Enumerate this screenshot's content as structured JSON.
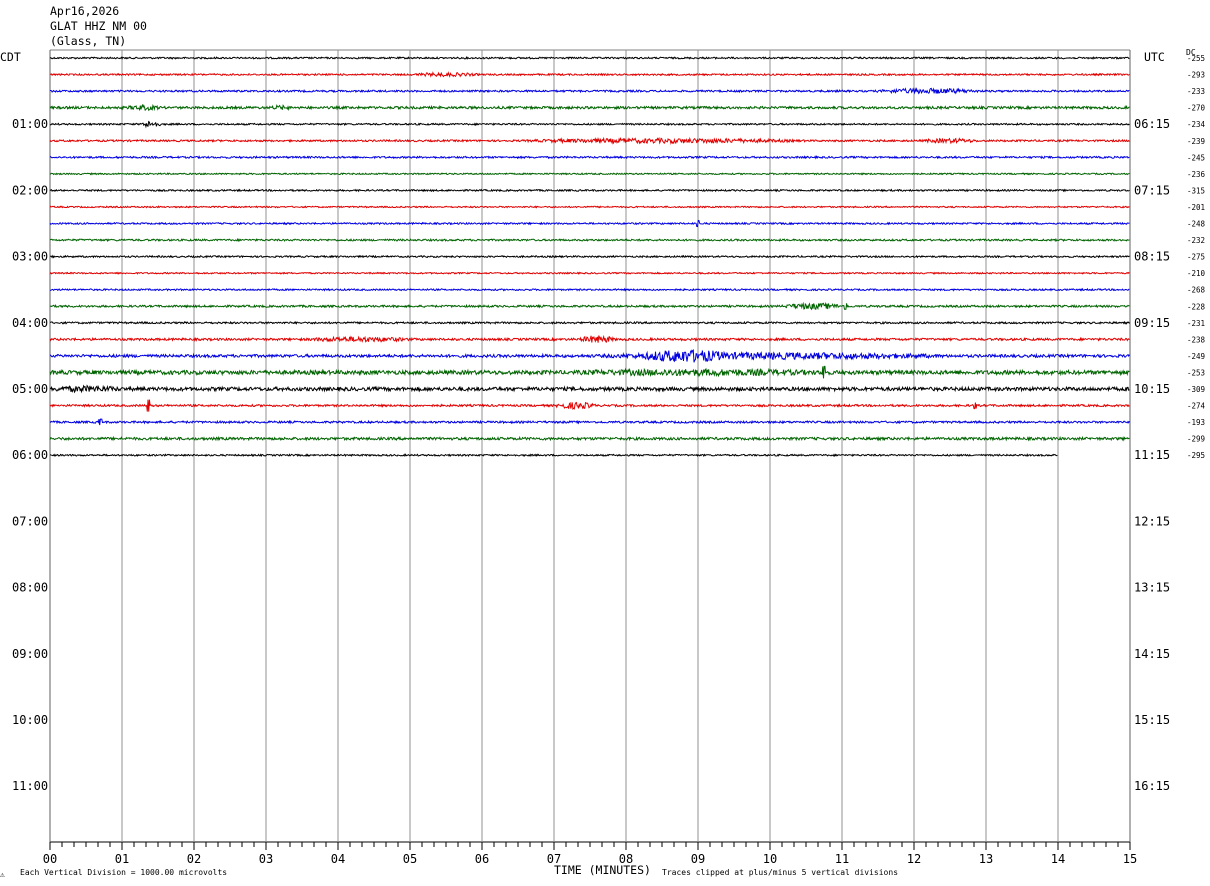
{
  "header": {
    "date": "Apr16,2026",
    "station": "GLAT HHZ NM 00",
    "location": "(Glass, TN)"
  },
  "labels": {
    "left_tz": "CDT",
    "right_tz": "UTC",
    "dc_header": "DC"
  },
  "footer": {
    "left_note": "Each Vertical Division = 1000.00 microvolts",
    "xlabel": "TIME (MINUTES)",
    "right_note": "Traces clipped at plus/minus 5 vertical divisions",
    "corner_mark": "⚠"
  },
  "chart_data": {
    "type": "line",
    "title": "GLAT HHZ NM 00",
    "xlabel": "TIME (MINUTES)",
    "xlim": [
      0,
      15
    ],
    "x_ticks": [
      "00",
      "01",
      "02",
      "03",
      "04",
      "05",
      "06",
      "07",
      "08",
      "09",
      "10",
      "11",
      "12",
      "13",
      "14",
      "15"
    ],
    "rows_total": 48,
    "rows_per_hour": 4,
    "left_hour_labels": [
      "01:00",
      "02:00",
      "03:00",
      "04:00",
      "05:00",
      "06:00",
      "07:00",
      "08:00",
      "09:00",
      "10:00",
      "11:00"
    ],
    "right_hour_labels": [
      "06:15",
      "07:15",
      "08:15",
      "09:15",
      "10:15",
      "11:15",
      "12:15",
      "13:15",
      "14:15",
      "15:15",
      "16:15"
    ],
    "trace_colors": [
      "#000000",
      "#e00000",
      "#0000e0",
      "#006400"
    ],
    "grid": true,
    "series": [
      {
        "start": "00:00",
        "dc": "-255",
        "amp": 0.8,
        "end_min": 15
      },
      {
        "start": "00:15",
        "dc": "-293",
        "amp": 0.8,
        "end_min": 15,
        "bursts": [
          [
            5.5,
            1.0,
            1.2
          ]
        ]
      },
      {
        "start": "00:30",
        "dc": "-233",
        "amp": 0.9,
        "end_min": 15,
        "bursts": [
          [
            12.2,
            1.5,
            1.8
          ]
        ]
      },
      {
        "start": "00:45",
        "dc": "-270",
        "amp": 1.2,
        "end_min": 15,
        "bursts": [
          [
            1.3,
            0.5,
            1.5
          ],
          [
            3.2,
            0.3,
            1.2
          ]
        ]
      },
      {
        "start": "01:00",
        "dc": "-234",
        "amp": 0.8,
        "end_min": 15,
        "bursts": [
          [
            1.4,
            0.3,
            2.5
          ]
        ]
      },
      {
        "start": "01:15",
        "dc": "-239",
        "amp": 0.9,
        "end_min": 15,
        "bursts": [
          [
            8.5,
            4.0,
            1.6
          ],
          [
            12.5,
            0.8,
            1.5
          ]
        ]
      },
      {
        "start": "01:30",
        "dc": "-245",
        "amp": 0.9,
        "end_min": 15
      },
      {
        "start": "01:45",
        "dc": "-236",
        "amp": 0.7,
        "end_min": 15
      },
      {
        "start": "02:00",
        "dc": "-315",
        "amp": 0.8,
        "end_min": 15
      },
      {
        "start": "02:15",
        "dc": "-201",
        "amp": 0.7,
        "end_min": 15
      },
      {
        "start": "02:30",
        "dc": "-248",
        "amp": 0.8,
        "end_min": 15,
        "spikes": [
          [
            9.0,
            3
          ]
        ]
      },
      {
        "start": "02:45",
        "dc": "-232",
        "amp": 0.9,
        "end_min": 15
      },
      {
        "start": "03:00",
        "dc": "-275",
        "amp": 0.8,
        "end_min": 15
      },
      {
        "start": "03:15",
        "dc": "-210",
        "amp": 0.7,
        "end_min": 15
      },
      {
        "start": "03:30",
        "dc": "-268",
        "amp": 0.8,
        "end_min": 15
      },
      {
        "start": "03:45",
        "dc": "-228",
        "amp": 1.0,
        "end_min": 15,
        "bursts": [
          [
            10.6,
            0.9,
            2.2
          ]
        ],
        "spikes": [
          [
            11.05,
            3
          ]
        ]
      },
      {
        "start": "04:00",
        "dc": "-231",
        "amp": 0.9,
        "end_min": 15
      },
      {
        "start": "04:15",
        "dc": "-238",
        "amp": 1.1,
        "end_min": 15,
        "bursts": [
          [
            4.3,
            1.5,
            1.6
          ],
          [
            7.6,
            0.5,
            2.8
          ]
        ]
      },
      {
        "start": "04:30",
        "dc": "-249",
        "amp": 1.4,
        "end_min": 15,
        "bursts": [
          [
            10.0,
            5.0,
            2.2
          ],
          [
            8.8,
            1.2,
            3.5
          ]
        ]
      },
      {
        "start": "04:45",
        "dc": "-253",
        "amp": 2.0,
        "end_min": 15,
        "bursts": [
          [
            9.0,
            3.5,
            1.6
          ]
        ],
        "spikes": [
          [
            10.75,
            6
          ]
        ]
      },
      {
        "start": "05:00",
        "dc": "-309",
        "amp": 1.8,
        "end_min": 15,
        "bursts": [
          [
            0.5,
            1.0,
            1.5
          ]
        ]
      },
      {
        "start": "05:15",
        "dc": "-274",
        "amp": 1.0,
        "end_min": 15,
        "bursts": [
          [
            7.3,
            0.6,
            2.5
          ]
        ],
        "spikes": [
          [
            1.37,
            6
          ],
          [
            12.85,
            3
          ]
        ]
      },
      {
        "start": "05:30",
        "dc": "-193",
        "amp": 1.0,
        "end_min": 15,
        "spikes": [
          [
            0.7,
            3
          ]
        ]
      },
      {
        "start": "05:45",
        "dc": "-299",
        "amp": 1.3,
        "end_min": 15
      },
      {
        "start": "06:00",
        "dc": "-295",
        "amp": 0.8,
        "end_min": 14
      }
    ]
  }
}
